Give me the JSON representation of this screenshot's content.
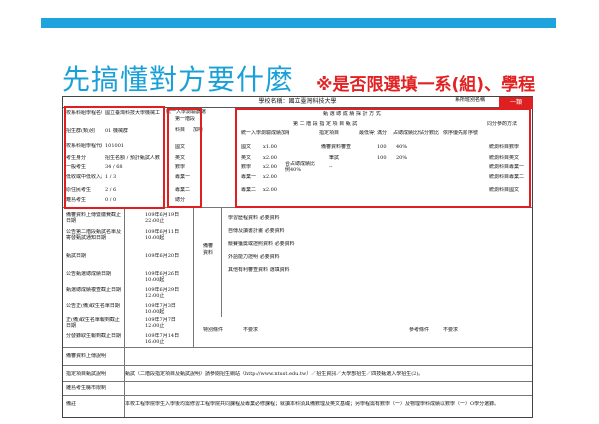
{
  "heading": "先搞懂對方要什麼",
  "note": "※是否限選填一系(組)、學程",
  "form": {
    "school": "學校名稱：國立臺灣科技大學",
    "dept_short": "系所班別名稱",
    "red_tab": "一類",
    "left_table": {
      "rows": [
        {
          "k": "校系科組學程名稱",
          "v": "國立臺灣科技大學機械工程系"
        },
        {
          "k": "招生群(類)別",
          "v": "01 機械群"
        },
        {
          "k": "校系科組學程代碼",
          "v": "101001"
        },
        {
          "k": "考生身分",
          "v": "招生名額 / 預計甄試人數"
        },
        {
          "k": "一般考生",
          "v": "34 / 68"
        },
        {
          "k": "低收或中低收入戶考生",
          "v": "1 / 3"
        },
        {
          "k": "原住民考生",
          "v": "2 / 6"
        },
        {
          "k": "離島考生",
          "v": "0 / 0"
        }
      ]
    },
    "exam": {
      "title": "統一入學測驗篩選",
      "first_stage": "第一階段",
      "col_subject": "科目",
      "col_weight": "加權",
      "subjects": [
        "國文",
        "英文",
        "數學",
        "專業一",
        "專業二"
      ],
      "weights": [
        "x1.00",
        "x2.00",
        "x2.00",
        "x2.00",
        "x2.00"
      ],
      "total": "總分"
    },
    "review": {
      "title": "甄 選 總 成 績 採 計 方 式",
      "second_stage": "第 二 階 段 指 定 項 目 甄 試",
      "headers": [
        "統一入學測驗成績加權",
        "指定項目",
        "最低得分",
        "滿分",
        "占總成績比例",
        "佔分數比",
        "依序優先順序",
        "序號"
      ],
      "items": [
        "備審資料審查",
        "筆試",
        "--"
      ],
      "ratios": [
        "100",
        "100"
      ],
      "percents": [
        "40%",
        "20%"
      ],
      "weight_note": "合占總成績比例40%",
      "same_score": "同分參酌方法",
      "same_score_items": [
        "統測科目數學",
        "統測科目英文",
        "統測科目專業一",
        "統測科目專業二",
        "統測科目國文"
      ]
    },
    "schedule": [
      {
        "k": "備審資料上傳暨繳費截止日期",
        "v": "109年6月19日 22:00止"
      },
      {
        "k": "公告第二階段甄試名單及寄發甄試通知日期",
        "v": "109年6月11日 10:00起"
      },
      {
        "k": "甄試日期",
        "v": "109年6月20日"
      },
      {
        "k": "公告甄選總成績日期",
        "v": "109年6月26日 10:00起"
      },
      {
        "k": "甄選總成績複查截止日期",
        "v": "109年6月29日 12:00止"
      },
      {
        "k": "公告正(備)取生名單日期",
        "v": "109年7月3日 10:00起"
      },
      {
        "k": "正(備)取生名單報到截止日期",
        "v": "109年7月7日 12:00止"
      },
      {
        "k": "分發錄取生報到截止日期",
        "v": "109年7月14日 16:00止"
      }
    ],
    "review_items": {
      "title": "備審資料",
      "items": [
        "學習歷程資料 必要資料",
        "自傳及讀書計畫 必要資料",
        "競賽獲獎或證照資料 必要資料",
        "外語能力證明 必要資料",
        "其他有利審查資料 選填資料"
      ]
    },
    "special": "特別條件",
    "special_val": "不要求",
    "reference": "參考條件",
    "reference_val": "不要求",
    "upload_note": "備審資料上傳說明",
    "exam_note": "指定項目甄試說明",
    "special_sites": "雕島考生縣市限制",
    "remarks": "備註",
    "footer1": "甄試（二階段指定項目及甄試說明）請參閱招生網站（http://www.ntust.edu.tw）／招生資訊／大學部招生／四技甄選入學招生(2)。",
    "footer2": "本校工程學院學生入學後均需修習工程學院共同課程及專業必修課程；就讀本科須具備數理及英文基礎；另學程需有數學（一）及物理學科成績以數學（一）O學分選錄。"
  }
}
